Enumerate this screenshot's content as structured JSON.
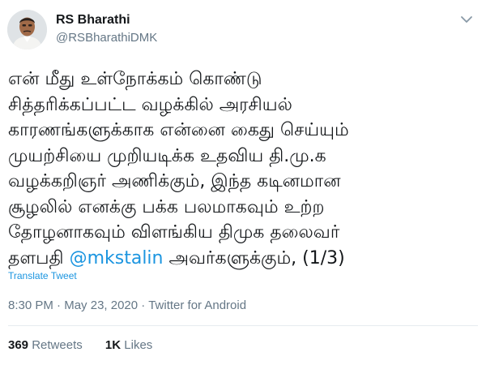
{
  "author": {
    "name": "RS Bharathi",
    "handle": "@RSBharathiDMK"
  },
  "tweet": {
    "lines": [
      "என் மீது உள்நோக்கம் கொண்டு",
      "சித்தரிக்கப்பட்ட வழக்கில் அரசியல்",
      "காரணங்களுக்காக என்னை கைது செய்யும்",
      "முயற்சியை முறியடிக்க உதவிய தி.மு.க",
      "வழக்கறிஞர் அணிக்கும், இந்த கடினமான",
      "சூழலில் எனக்கு பக்க பலமாகவும் உற்ற",
      "தோழனாகவும் விளங்கிய திமுக தலைவர்"
    ],
    "last_line_prefix": "தளபதி ",
    "mention": "@mkstalin",
    "last_line_suffix": " அவர்களுக்கும், (1/3)",
    "translate_label": "Translate Tweet"
  },
  "meta": {
    "time": "8:30 PM",
    "separator": " · ",
    "date": "May 23, 2020",
    "source": "Twitter for Android"
  },
  "stats": {
    "retweets_count": "369",
    "retweets_label": "Retweets",
    "likes_count": "1K",
    "likes_label": "Likes"
  },
  "colors": {
    "link": "#1b95e0",
    "secondary_text": "#657786",
    "primary_text": "#14171a"
  }
}
